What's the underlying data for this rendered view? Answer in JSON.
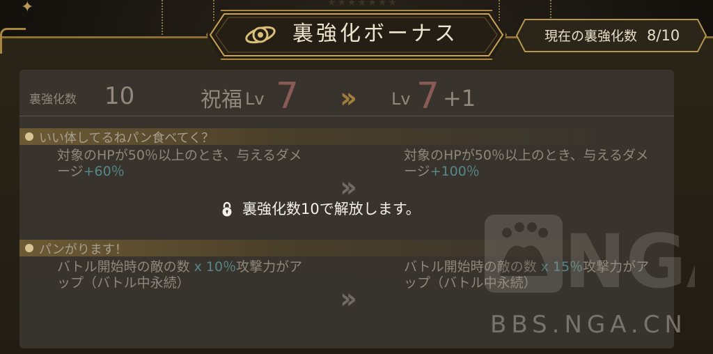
{
  "header": {
    "title": "裏強化ボーナス",
    "icon": "planet-icon",
    "enhance_count_label": "現在の裏強化数",
    "enhance_count_value": "8/10"
  },
  "level_row": {
    "enhance_label": "裏強化数",
    "enhance_value": "10",
    "blessing_label": "祝福",
    "lv_prefix": "Lv",
    "current_level": "7",
    "next_level": "7",
    "next_bonus": "+1"
  },
  "skills": [
    {
      "title": "いい体してるねパン食べてく？",
      "current_desc": "対象のHPが50％以上のとき、与えるダメージ",
      "current_value": "+60％",
      "next_desc": "対象のHPが50％以上のとき、与えるダメージ",
      "next_value": "+100％"
    },
    {
      "title": "パンがります！",
      "current_desc_pre": "バトル開始時の敵の数",
      "current_mult": "x",
      "current_value": "10％",
      "current_desc_post": "攻撃力がアップ（バトル中永続）",
      "next_desc_pre": "バトル開始時の敵の数",
      "next_mult": "x",
      "next_value": "15％",
      "next_desc_post": "攻撃力がアップ（バトル中永続）"
    }
  ],
  "lock": {
    "message": "裏強化数10で解放します。",
    "icon": "lock-icon"
  },
  "watermark": {
    "logo": "NGA",
    "text": "BBS.NGA.CN"
  },
  "colors": {
    "gold": "#a9873f",
    "level_red": "#8a5a57",
    "highlight_teal": "#56888a"
  }
}
